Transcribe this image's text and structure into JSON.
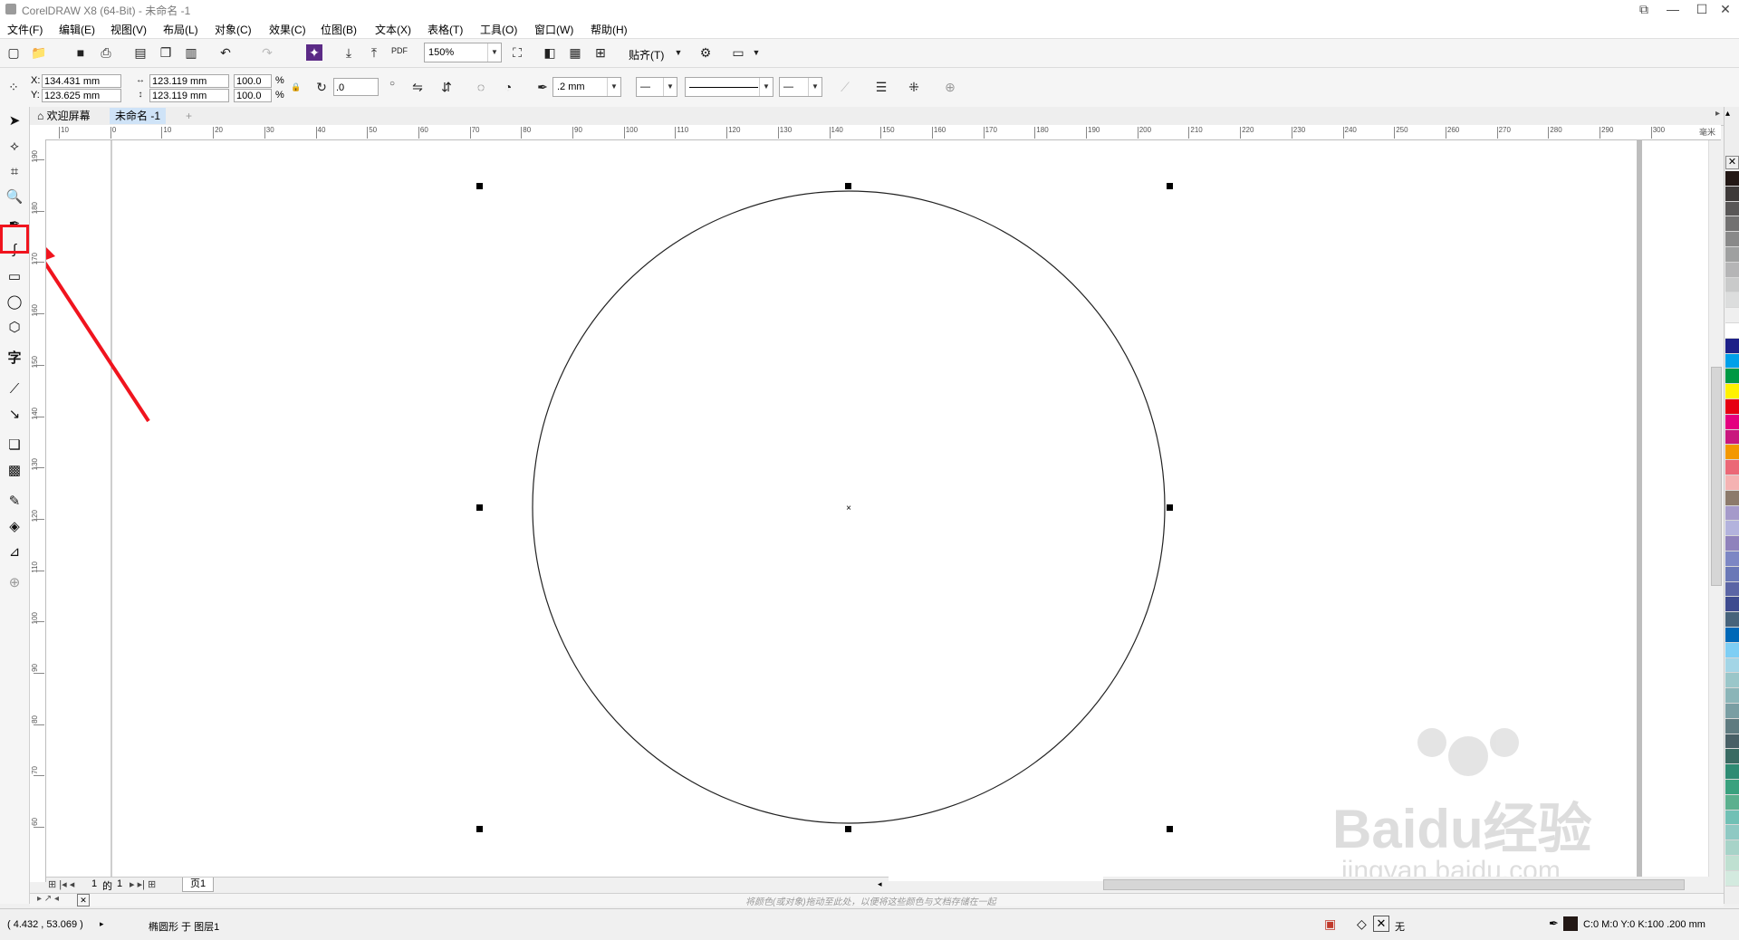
{
  "window": {
    "title": "CorelDRAW X8 (64-Bit) - 未命名 -1",
    "controls": {
      "restore": "⧉",
      "minimize": "—",
      "maximize": "☐",
      "close": "✕"
    }
  },
  "menu": [
    "文件(F)",
    "编辑(E)",
    "视图(V)",
    "布局(L)",
    "对象(C)",
    "效果(C)",
    "位图(B)",
    "文本(X)",
    "表格(T)",
    "工具(O)",
    "窗口(W)",
    "帮助(H)"
  ],
  "standard_toolbar": {
    "zoom_level": "150%",
    "snap_label": "贴齐(T)",
    "pdf_label": "PDF"
  },
  "property_bar": {
    "x_label": "X:",
    "x_value": "134.431 mm",
    "y_label": "Y:",
    "y_value": "123.625 mm",
    "width_value": "123.119 mm",
    "height_value": "123.119 mm",
    "scale_x": "100.0",
    "scale_y": "100.0",
    "percent": "%",
    "rotation": ".0",
    "outline_width": ".2 mm"
  },
  "doc_tabs": [
    {
      "label": "欢迎屏幕",
      "active": false
    },
    {
      "label": "未命名 -1",
      "active": true
    }
  ],
  "ruler": {
    "h_ticks": [
      "10",
      "0",
      "10",
      "20",
      "30",
      "40",
      "50",
      "60",
      "70",
      "80",
      "90",
      "100",
      "110",
      "120",
      "130",
      "140",
      "150",
      "160",
      "170",
      "180",
      "190",
      "200",
      "210",
      "220",
      "230",
      "240",
      "250",
      "260",
      "270",
      "280",
      "290",
      "300"
    ],
    "unit": "毫米",
    "v_ticks": [
      "190",
      "180",
      "170",
      "160",
      "150",
      "140",
      "130",
      "120",
      "110",
      "100",
      "90",
      "80",
      "70",
      "60"
    ]
  },
  "page_nav": {
    "current": "1",
    "of": "的",
    "total": "1",
    "page_tab": "页1"
  },
  "hint": "将颜色(或对象)拖动至此处，以便将这些颜色与文档存储在一起",
  "status": {
    "coords": "( 4.432 , 53.069 )",
    "selection": "椭圆形 于 图层1",
    "fill_none": "无",
    "outline_info": "C:0 M:0 Y:0 K:100  .200 mm"
  },
  "watermark": {
    "brand": "Baidu经验",
    "url": "jingyan.baidu.com"
  },
  "colors": {
    "highlight": "#f0141e",
    "palette": [
      "#231815",
      "#3e3a39",
      "#595757",
      "#727171",
      "#898989",
      "#9fa0a0",
      "#b5b5b6",
      "#c9caca",
      "#dcdddd",
      "#efefef",
      "#ffffff",
      "#1d2088",
      "#00a0e9",
      "#009944",
      "#fff100",
      "#e60012",
      "#e4007f",
      "#c9177e",
      "#f39800",
      "#eb6877",
      "#f5b2b2",
      "#8c7a6b",
      "#a59aca",
      "#b3b3dd",
      "#8f82bc",
      "#7d87c4",
      "#6a78b7",
      "#5b65a5",
      "#3e4b8f",
      "#47637b",
      "#0068b7",
      "#7ecef4",
      "#a3d5e6",
      "#9ac6c9",
      "#8bb5b8",
      "#7a9ea3",
      "#5f7b80",
      "#496066",
      "#3a6b63",
      "#2e8b73",
      "#3aa17e",
      "#5bb08e",
      "#71c0b5",
      "#8fc9c3",
      "#a7d3c8",
      "#bfe0d1",
      "#d3eadf"
    ]
  }
}
